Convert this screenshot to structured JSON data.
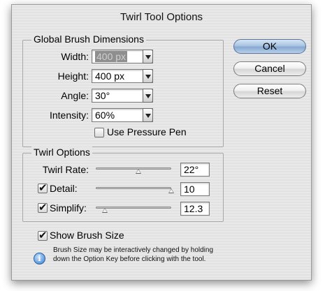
{
  "dialog": {
    "title": "Twirl Tool Options",
    "buttons": {
      "ok": "OK",
      "cancel": "Cancel",
      "reset": "Reset"
    }
  },
  "global_brush": {
    "group_label": "Global Brush Dimensions",
    "width": {
      "label": "Width:",
      "value": "400 px"
    },
    "height": {
      "label": "Height:",
      "value": "400 px"
    },
    "angle": {
      "label": "Angle:",
      "value": "30°"
    },
    "intensity": {
      "label": "Intensity:",
      "value": "60%"
    },
    "use_pressure_pen": {
      "label": "Use Pressure Pen",
      "checked": false
    }
  },
  "twirl_options": {
    "group_label": "Twirl Options",
    "twirl_rate": {
      "label": "Twirl Rate:",
      "value": "22°"
    },
    "detail": {
      "label": "Detail:",
      "value": "10",
      "checked": true
    },
    "simplify": {
      "label": "Simplify:",
      "value": "12.3",
      "checked": true
    }
  },
  "show_brush_size": {
    "label": "Show Brush Size",
    "checked": true
  },
  "hint": {
    "line1": "Brush Size may be interactively changed by holding",
    "line2": "down the Option Key before clicking with the tool."
  },
  "icons": {
    "info": "info-icon"
  }
}
